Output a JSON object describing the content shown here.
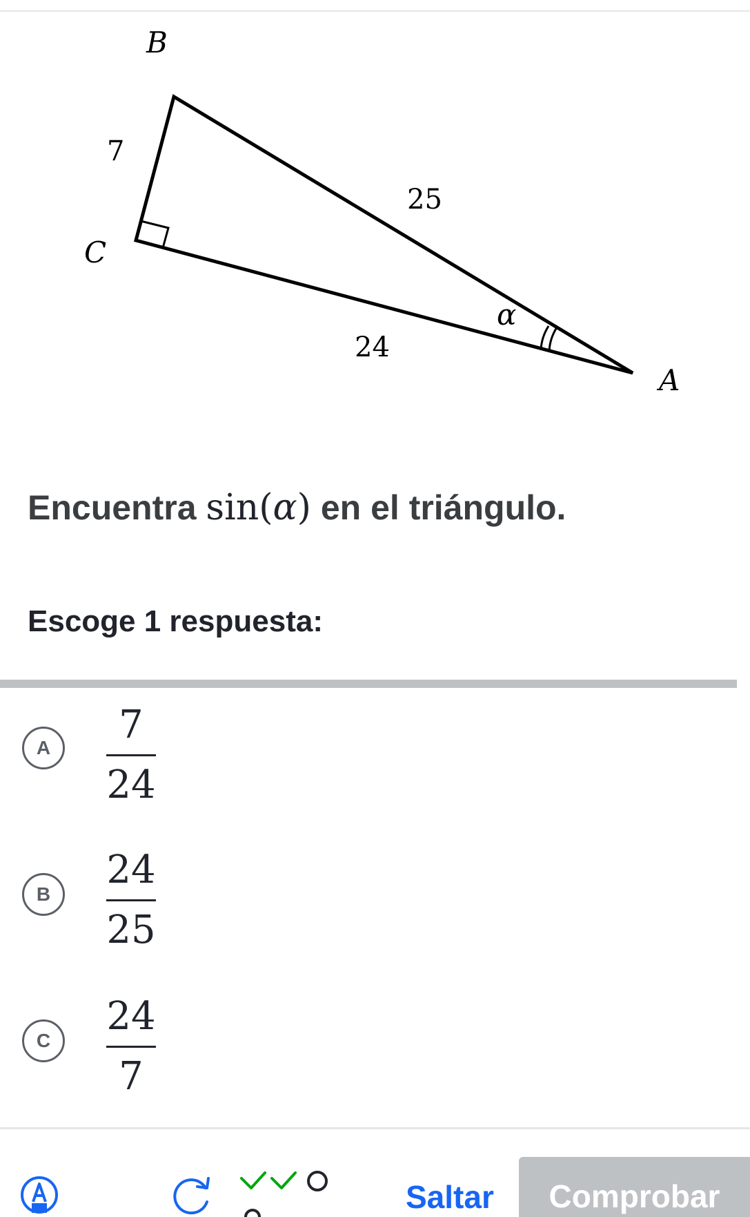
{
  "diagram": {
    "vertex_a": "A",
    "vertex_b": "B",
    "vertex_c": "C",
    "side_bc": "7",
    "side_ab": "25",
    "side_ac": "24",
    "angle_label": "α"
  },
  "question": {
    "prefix": "Encuentra",
    "func": "sin",
    "open_paren": "(",
    "variable": "α",
    "close_paren": ")",
    "suffix": "en el triángulo."
  },
  "instruction": "Escoge 1 respuesta:",
  "choices": [
    {
      "letter": "A",
      "numerator": "7",
      "denominator": "24"
    },
    {
      "letter": "B",
      "numerator": "24",
      "denominator": "25"
    },
    {
      "letter": "C",
      "numerator": "24",
      "denominator": "7"
    }
  ],
  "footer": {
    "skip_label": "Saltar",
    "check_label": "Comprobar",
    "progress": [
      "correct",
      "correct",
      "pending"
    ]
  },
  "colors": {
    "text": "#21242c",
    "link": "#1865f2",
    "correct": "#00a60e",
    "disabled": "#bec1c4"
  },
  "icons": {
    "tools": "highlighter-icon",
    "redo": "restart-icon",
    "progress": "streak-progress-icon"
  }
}
